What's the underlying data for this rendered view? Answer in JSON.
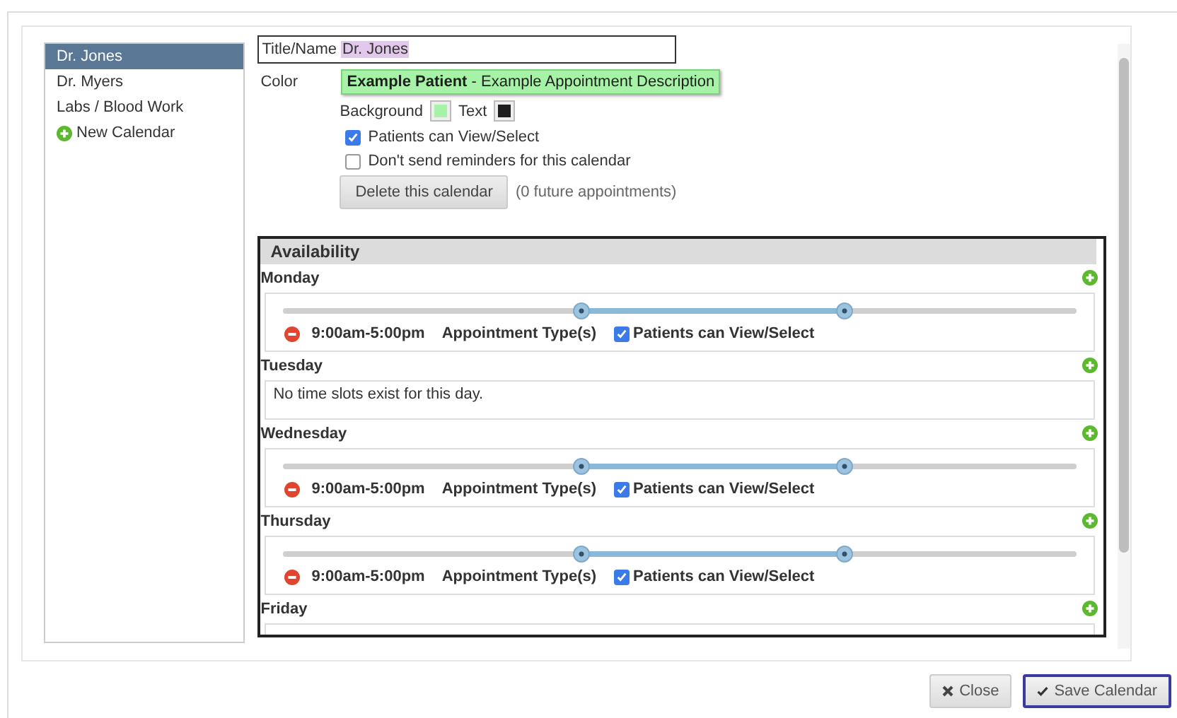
{
  "sidebar": {
    "items": [
      {
        "label": "Dr. Jones",
        "selected": true,
        "kind": "calendar"
      },
      {
        "label": "Dr. Myers",
        "selected": false,
        "kind": "calendar"
      },
      {
        "label": "Labs / Blood Work",
        "selected": false,
        "kind": "calendar"
      },
      {
        "label": "New Calendar",
        "selected": false,
        "kind": "add"
      }
    ]
  },
  "form": {
    "title_label": "Title/Name",
    "title_value": "Dr. Jones",
    "color_label": "Color",
    "preview": "**Example Patient** - Example Appointment Description",
    "swatches": [
      {
        "label": "Background",
        "color": "#a6f2a6"
      },
      {
        "label": "Text",
        "color": "#1e1e1e"
      }
    ],
    "options": [
      {
        "label": "Patients can View/Select",
        "checked": true
      },
      {
        "label": "Don't send reminders for this calendar",
        "checked": false
      }
    ],
    "delete_button": "Delete this calendar",
    "future_note": "(0 future appointments)"
  },
  "availability": {
    "title": "Availability",
    "days": [
      {
        "name": "Monday",
        "kind": "slots",
        "slots": [
          {
            "time": "9:00am-5:00pm",
            "types": "Appointment Type(s)",
            "view_label": "Patients can View/Select",
            "view_checked": true,
            "handles": [
              {
                "level": 0.375
              },
              {
                "level": 0.708
              }
            ]
          }
        ]
      },
      {
        "name": "Tuesday",
        "kind": "empty",
        "message": "No time slots exist for this day."
      },
      {
        "name": "Wednesday",
        "kind": "slots",
        "slots": [
          {
            "time": "9:00am-5:00pm",
            "types": "Appointment Type(s)",
            "view_label": "Patients can View/Select",
            "view_checked": true,
            "handles": [
              {
                "level": 0.375
              },
              {
                "level": 0.708
              }
            ]
          }
        ]
      },
      {
        "name": "Thursday",
        "kind": "slots",
        "slots": [
          {
            "time": "9:00am-5:00pm",
            "types": "Appointment Type(s)",
            "view_label": "Patients can View/Select",
            "view_checked": true,
            "handles": [
              {
                "level": 0.375
              },
              {
                "level": 0.708
              }
            ]
          }
        ]
      },
      {
        "name": "Friday",
        "kind": "slots"
      }
    ]
  },
  "buttons": [
    {
      "label": "Close",
      "kind": "close",
      "primary": false
    },
    {
      "label": "Save Calendar",
      "kind": "save",
      "primary": true
    }
  ]
}
